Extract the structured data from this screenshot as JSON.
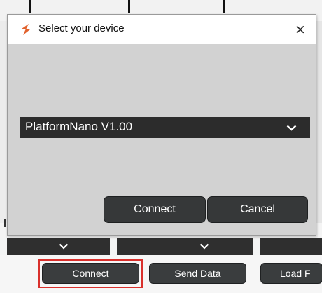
{
  "dialog": {
    "title": "Select your device",
    "close_symbol": "×",
    "app_icon": "app-logo-icon",
    "device_select": {
      "value": "PlatformNano V1.00",
      "icon": "chevron-down-icon"
    },
    "connect_label": "Connect",
    "cancel_label": "Cancel"
  },
  "background": {
    "dropdown_icon": "chevron-down-icon",
    "buttons": {
      "connect_label": "Connect",
      "send_data_label": "Send Data",
      "load_label": "Load F"
    },
    "highlight_color": "#d9302c"
  }
}
